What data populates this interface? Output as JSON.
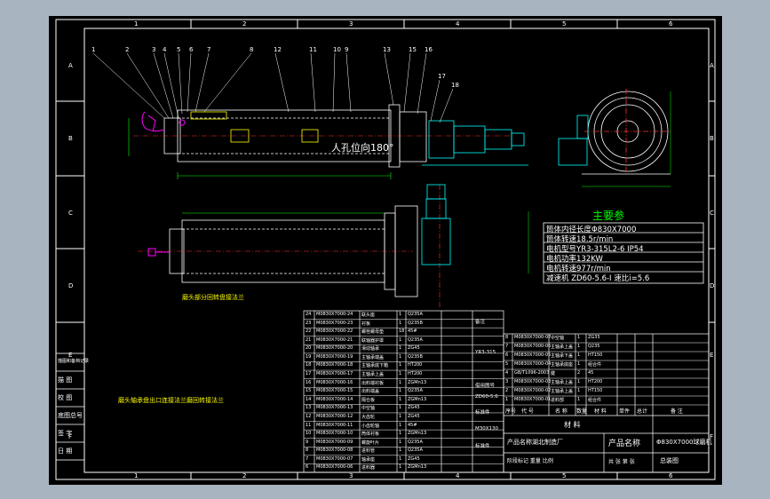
{
  "frame": {
    "col_numbers_top": [
      "1",
      "2",
      "3",
      "4",
      "5",
      "6"
    ],
    "col_numbers_bottom": [
      "1",
      "2",
      "3",
      "4",
      "5",
      "6"
    ],
    "row_letters_left": [
      "A",
      "B",
      "C",
      "D",
      "E",
      "F"
    ],
    "row_letters_right": [
      "A",
      "B",
      "C",
      "D",
      "E",
      "F"
    ],
    "side_table_labels": [
      "描图和备档记录",
      "描 图",
      "校 图",
      "底图总号",
      "签 字",
      "日 期"
    ]
  },
  "callouts": [
    "1",
    "2",
    "3",
    "4",
    "5",
    "6",
    "7",
    "8",
    "12",
    "11",
    "10",
    "9",
    "13",
    "15",
    "16",
    "17",
    "18"
  ],
  "annotations": {
    "hole_note": "人孔位向180°",
    "plan_note": "磨头部分回转盘接法兰",
    "lower_note": "磨头轴承盘出口连接法兰磨回转接法兰"
  },
  "params": {
    "title": "主要参",
    "rows": [
      "筒体内径长度Φ830X7000",
      "筒体转速18.5r/min",
      "电机型号YR3-315L2-6  IP54",
      "电机功率132KW",
      "电机转速977r/min",
      "减速机  ZD60-5.6-I  速比i=5.6"
    ]
  },
  "bom_left": {
    "rows": [
      [
        "24",
        "M0830X7000-24",
        "联头座",
        "1",
        "Q235A"
      ],
      [
        "23",
        "M0830X7000-23",
        "衬板",
        "1",
        "Q235B"
      ],
      [
        "22",
        "M0830X7000-22",
        "螺栓螺母垫",
        "18",
        "45#"
      ],
      [
        "21",
        "M0830X7000-21",
        "联轴器护罩",
        "1",
        "Q235A"
      ],
      [
        "20",
        "M0830X7000-20",
        "滑动轴承",
        "1",
        "ZG45"
      ],
      [
        "19",
        "M0830X7000-19",
        "主轴承端盖",
        "1",
        "Q235B"
      ],
      [
        "18",
        "M0830X7000-18",
        "主轴承底下箱",
        "1",
        "HT200"
      ],
      [
        "17",
        "M0830X7000-17",
        "主轴承上盖",
        "1",
        "HT200"
      ],
      [
        "16",
        "M0830X7000-16",
        "出料端衬板",
        "1",
        "ZGMn13"
      ],
      [
        "15",
        "M0830X7000-15",
        "出料端盖",
        "1",
        "Q235A"
      ],
      [
        "14",
        "M0830X7000-14",
        "隔仓板",
        "1",
        "ZGMn13"
      ],
      [
        "13",
        "M0830X7000-13",
        "中空轴",
        "1",
        "ZG45"
      ],
      [
        "12",
        "M0830X7000-12",
        "大齿轮",
        "1",
        "ZG45"
      ],
      [
        "11",
        "M0830X7000-11",
        "小齿轮轴",
        "1",
        "45#"
      ],
      [
        "10",
        "M0830X7000-10",
        "筒体衬板",
        "1",
        "ZGMn13"
      ],
      [
        "9",
        "M0830X7000-09",
        "螺旋叶片",
        "1",
        "Q235A"
      ],
      [
        "8",
        "M0830X7000-08",
        "进料管",
        "1",
        "Q235A"
      ],
      [
        "7",
        "M0830X7000-07",
        "轴承座",
        "1",
        "ZG45"
      ],
      [
        "6",
        "M0830X7000-06",
        "进料器",
        "1",
        "ZGMn13"
      ]
    ],
    "side_labels": [
      "备注",
      "YR3-315",
      "借用图号",
      "ZD60-5.6",
      "标准件",
      "标准件",
      "M30X130"
    ]
  },
  "bom_right": {
    "rows": [
      [
        "8",
        "M0830X7000-07",
        "中空轴",
        "1",
        "ZG35"
      ],
      [
        "7",
        "M0830X7000-06",
        "主轴承上盖",
        "1",
        "Q235"
      ],
      [
        "6",
        "M0830X7000-05",
        "主轴承下盖",
        "1",
        "HT150"
      ],
      [
        "5",
        "M0830X7000-04",
        "主轴承底座",
        "1",
        "组合件"
      ],
      [
        "4",
        "GB/T1096-2003",
        "键",
        "2",
        "45"
      ],
      [
        "3",
        "M0830X7000-03",
        "主轴承上盖",
        "1",
        "HT200"
      ],
      [
        "2",
        "M0830X7000-02",
        "主轴承上盖",
        "1",
        "HT150"
      ],
      [
        "1",
        "M0830X7000-01",
        "进料部",
        "1",
        "组合件"
      ]
    ],
    "header": [
      "序号",
      "代 号",
      "名 称",
      "数量",
      "材 料",
      "单件",
      "总计",
      "备 注"
    ]
  },
  "title_block": {
    "material": "材 料",
    "company": "产品名称湖北制造厂",
    "product": "产品名称",
    "model": "Φ830X7000球磨机",
    "drawing_name": "总装图",
    "scale_row": "阶段标记  重量  比例",
    "sheet_row": "共 张  第 张"
  }
}
